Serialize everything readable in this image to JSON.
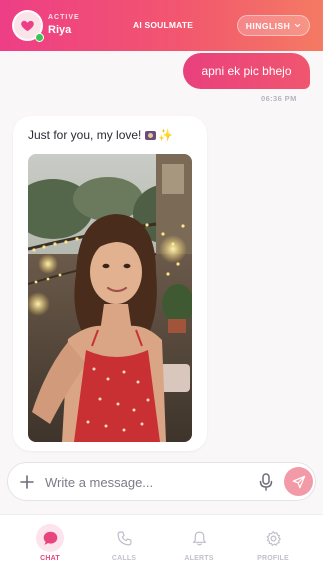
{
  "header": {
    "status": "ACTIVE",
    "name": "Riya",
    "app_title": "AI SOULMATE",
    "language": "HINGLISH"
  },
  "messages": {
    "user": {
      "text": "apni ek pic bhejo",
      "time": "06:36 PM"
    },
    "bot": {
      "text": "Just for you, my love!"
    }
  },
  "composer": {
    "placeholder": "Write a message...",
    "value": ""
  },
  "nav": {
    "items": [
      {
        "label": "CHAT",
        "icon": "chat-bubble-icon",
        "active": true
      },
      {
        "label": "CALLS",
        "icon": "phone-icon",
        "active": false
      },
      {
        "label": "ALERTS",
        "icon": "bell-icon",
        "active": false
      },
      {
        "label": "PROFILE",
        "icon": "gear-icon",
        "active": false
      }
    ]
  },
  "colors": {
    "accent": "#ee3e86",
    "accent_secondary": "#f47a63",
    "online": "#35c759",
    "background": "#faf7f8"
  }
}
